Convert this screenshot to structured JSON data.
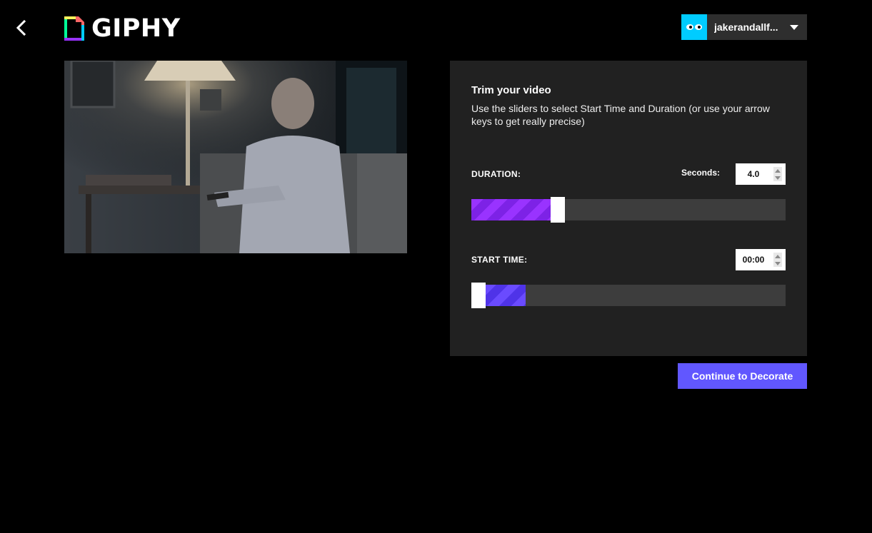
{
  "header": {
    "logo_text": "GIPHY",
    "username": "jakerandallf...",
    "back_icon": "chevron-left-icon",
    "menu_icon": "caret-down-icon"
  },
  "trim": {
    "title": "Trim your video",
    "description": "Use the sliders to select Start Time and Duration (or use your arrow keys to get really precise)",
    "duration_label": "DURATION:",
    "seconds_label": "Seconds:",
    "duration_value": "4.0",
    "start_label": "START TIME:",
    "start_value": "00:00"
  },
  "actions": {
    "continue_label": "Continue to Decorate"
  },
  "colors": {
    "accent_button": "#6157ff",
    "duration_fill": "#9933ff",
    "start_fill": "#6a4bff",
    "avatar_bg": "#00ccff"
  }
}
